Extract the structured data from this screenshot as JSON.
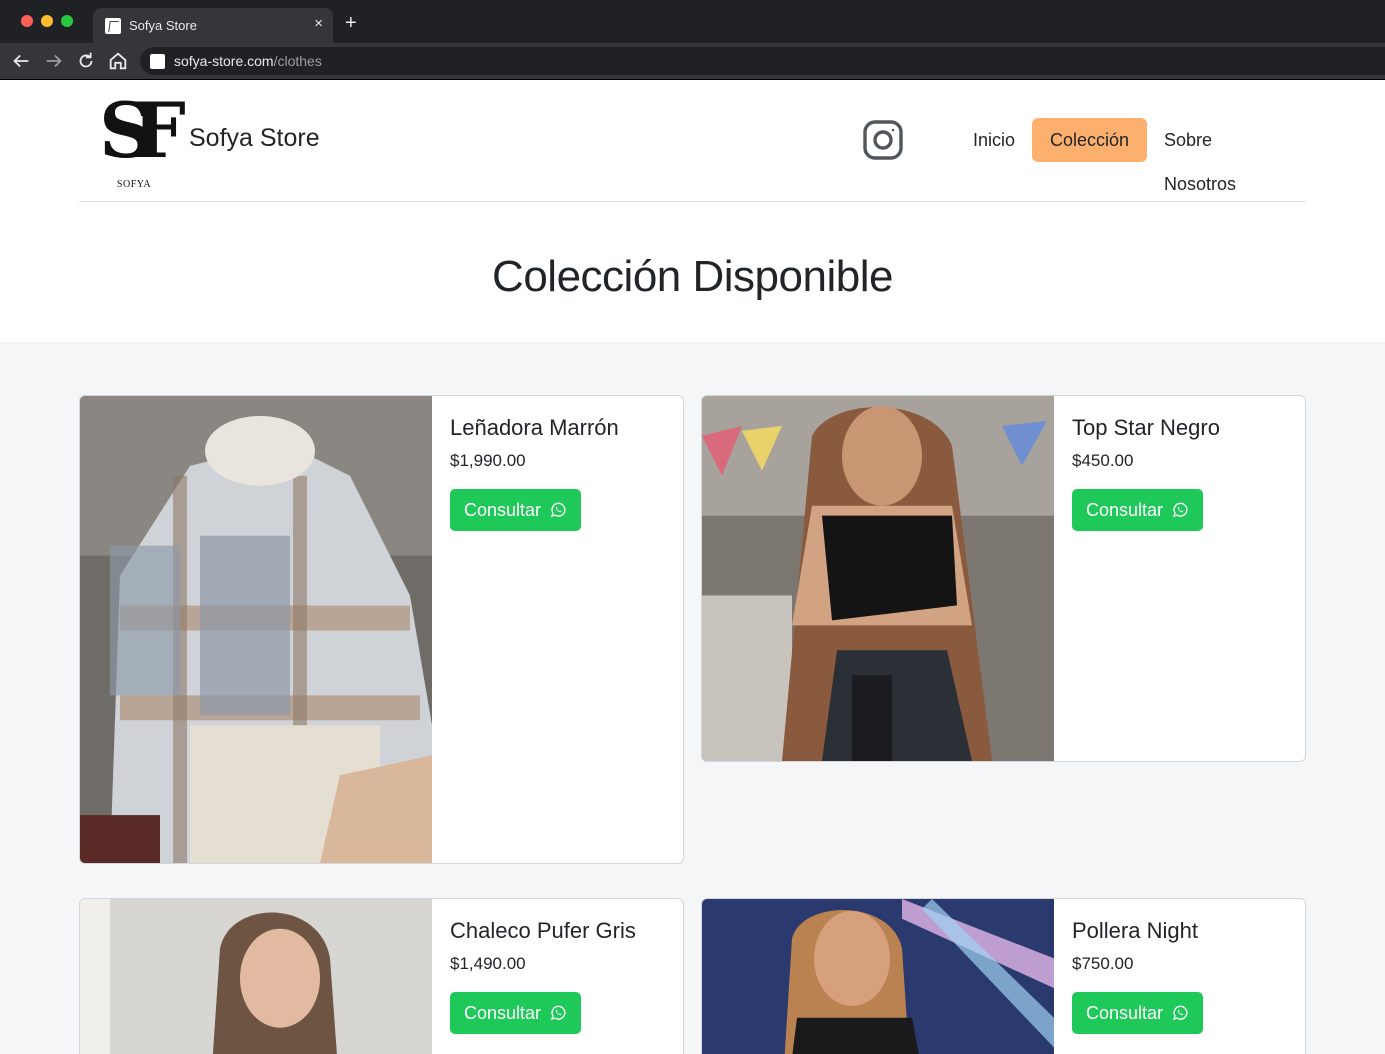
{
  "browser": {
    "tab_title": "Sofya Store",
    "tab_close": "×",
    "new_tab": "+",
    "url_host": "sofya-store.com",
    "url_path": "/clothes"
  },
  "header": {
    "logo_letters": "SF",
    "logo_caption": "SOFYA",
    "brand_name": "Sofya Store",
    "instagram_icon": "instagram-icon",
    "nav": [
      {
        "label": "Inicio",
        "active": false
      },
      {
        "label": "Colección",
        "active": true
      },
      {
        "label": "Sobre Nosotros",
        "active": false
      }
    ],
    "active_color": "#fdaf6e"
  },
  "page": {
    "title": "Colección Disponible"
  },
  "products": [
    {
      "name": "Leñadora Marrón",
      "price": "$1,990.00",
      "button": "Consultar",
      "button_icon": "whatsapp-icon"
    },
    {
      "name": "Top Star Negro",
      "price": "$450.00",
      "button": "Consultar",
      "button_icon": "whatsapp-icon"
    },
    {
      "name": "Chaleco Pufer Gris",
      "price": "$1,490.00",
      "button": "Consultar",
      "button_icon": "whatsapp-icon"
    },
    {
      "name": "Pollera Night",
      "price": "$750.00",
      "button": "Consultar",
      "button_icon": "whatsapp-icon"
    }
  ],
  "colors": {
    "consult_button": "#1ec95a",
    "products_background": "#f5f6f8"
  }
}
